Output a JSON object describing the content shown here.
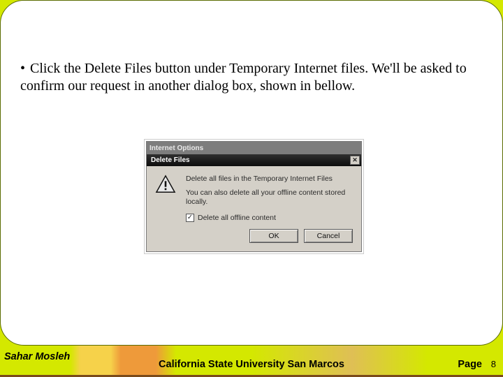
{
  "slide": {
    "bullet_text": "Click the Delete Files button under Temporary Internet files. We'll be asked to confirm our request in another dialog box, shown in bellow."
  },
  "dialog": {
    "parent_title": "Internet Options",
    "title": "Delete Files",
    "line1": "Delete all files in the Temporary Internet Files",
    "line2": "You can also delete all your offline content stored locally.",
    "checkbox_label": "Delete all offline content",
    "checkbox_checked": "✓",
    "ok_label": "OK",
    "cancel_label": "Cancel",
    "close_glyph": "✕"
  },
  "footer": {
    "author": "Sahar Mosleh",
    "center": "California State University San Marcos",
    "page_label": "Page",
    "page_number": "8"
  }
}
